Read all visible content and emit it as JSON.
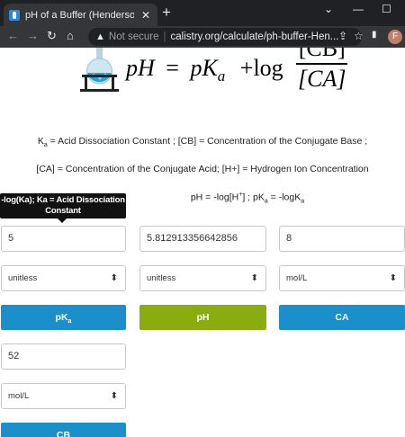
{
  "browser": {
    "tab_title": "pH of a Buffer (Henderson Equat",
    "tab_close": "✕",
    "new_tab": "+",
    "not_secure": "Not secure",
    "url": "calistry.org/calculate/ph-buffer-Hen...",
    "avatar_letter": "F"
  },
  "formula": {
    "lhs": "pH",
    "equals": "=",
    "pk": "pK",
    "pk_sub": "a",
    "plus_log": "+log",
    "numerator": "[CB]",
    "denominator": "[CA]"
  },
  "legend": {
    "line1_ka": "K",
    "line1_ka_sub": "a",
    "line1_rest": " =  Acid Dissociation Constant ; [CB] = Concentration of the Conjugate Base ;",
    "line2": "[CA] = Concentration of the Conjugate Acid; [H+] = Hydrogen Ion Concentration",
    "line3_a": "pH = -log[H",
    "line3_sup": "+",
    "line3_b": "] ; pK",
    "line3_sub1": "a",
    "line3_c": " = -logK",
    "line3_sub2": "a"
  },
  "tooltip": {
    "text1": "-log(Ka); Ka = Acid Dissociation",
    "text2": "Constant"
  },
  "calculator": {
    "pka_value": "5",
    "ph_value": "5.812913356642856",
    "ca_value": "8",
    "cb_value": "52",
    "pka_unit": "unitless",
    "ph_unit": "unitless",
    "ca_unit": "mol/L",
    "cb_unit": "mol/L",
    "pka_button_main": "pK",
    "pka_button_sub": "a",
    "ph_button": "pH",
    "ca_button": "CA",
    "cb_button": "CB"
  },
  "colors": {
    "blue_button": "#1a8fc9",
    "green_button": "#8aac0e"
  }
}
